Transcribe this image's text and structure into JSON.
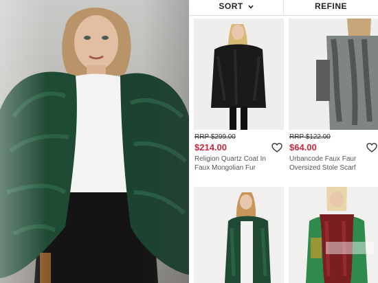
{
  "toolbar": {
    "sort_label": "SORT",
    "refine_label": "REFINE"
  },
  "products": [
    {
      "rrp": "RRP $299.00",
      "price": "$214.00",
      "name": "Religion Quartz Coat In Faux Mongolian Fur"
    },
    {
      "rrp": "RRP $122.00",
      "price": "$64.00",
      "name": "Urbancode Faux Faur Oversized Stole Scarf"
    }
  ],
  "icons": {
    "sort_chevron": "chevron-down-icon",
    "wishlist": "heart-outline-icon"
  },
  "colors": {
    "sale_price": "#c6283e",
    "coat_green": "#1f4a34",
    "scarf_red": "#7a1e22"
  }
}
